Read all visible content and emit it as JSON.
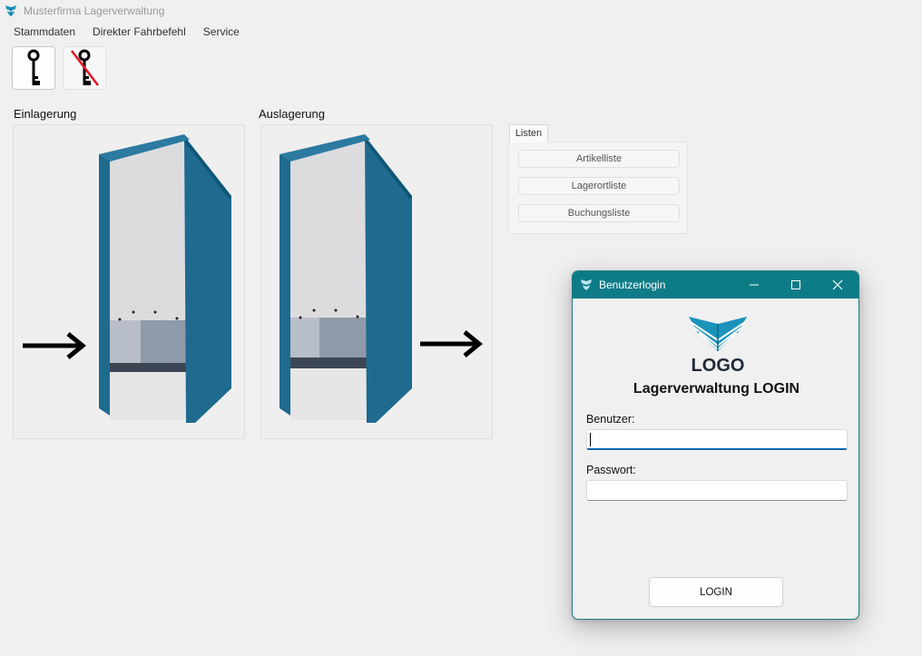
{
  "window": {
    "title": "Musterfirma Lagerverwaltung",
    "icon": "app-logo-icon"
  },
  "menu": {
    "items": [
      "Stammdaten",
      "Direkter Fahrbefehl",
      "Service"
    ]
  },
  "toolbar": {
    "login_icon": "key-icon",
    "logout_icon": "key-crossed-icon",
    "crossed_color": "#e0141e"
  },
  "sections": {
    "einlagerung": "Einlagerung",
    "auslagerung": "Auslagerung"
  },
  "tabs": {
    "active": "Listen",
    "buttons": [
      "Artikelliste",
      "Lagerortliste",
      "Buchungsliste"
    ]
  },
  "login_dialog": {
    "title": "Benutzerlogin",
    "logo_text": "LOGO",
    "heading": "Lagerverwaltung LOGIN",
    "user_label": "Benutzer:",
    "user_value": "",
    "password_label": "Passwort:",
    "password_value": "",
    "button": "LOGIN"
  },
  "colors": {
    "dialog_titlebar": "#0e7c86",
    "storage_blue": "#1f6a8f",
    "logo_cyan": "#1b93ba",
    "input_focus": "#0f67b1"
  }
}
